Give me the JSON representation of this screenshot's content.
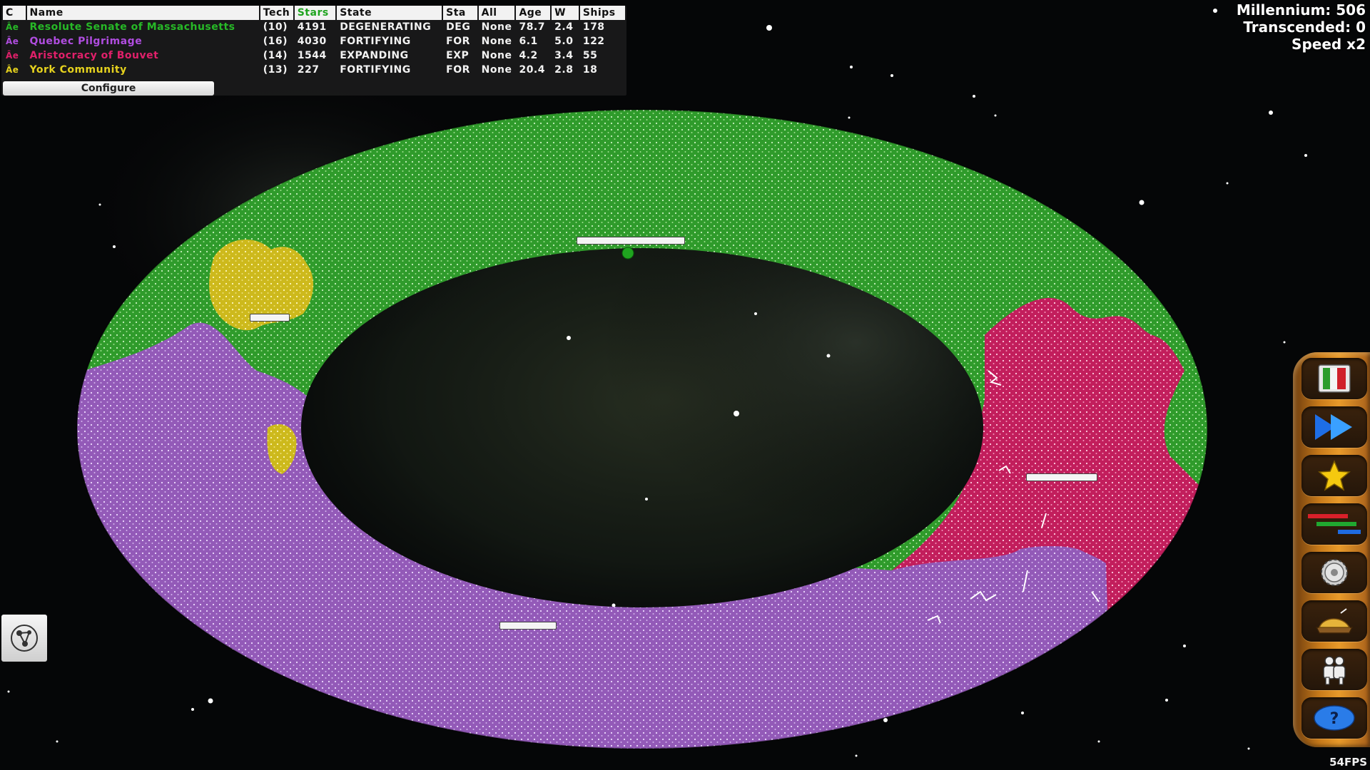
{
  "table": {
    "headers": {
      "c": "C",
      "name": "Name",
      "tech": "Tech",
      "stars": "Stars",
      "state": "State",
      "sta": "Sta",
      "all": "All",
      "age": "Age",
      "w": "W",
      "ships": "Ships"
    },
    "rows": [
      {
        "glyph": "Âe",
        "name": "Resolute Senate of Massachusetts",
        "color": "#27b927",
        "tech": "(10)",
        "stars": "4191",
        "state": "DEGENERATING",
        "sta": "DEG",
        "all": "None",
        "age": "78.7",
        "w": "2.4",
        "ships": "178"
      },
      {
        "glyph": "Âe",
        "name": "Quebec Pilgrimage",
        "color": "#b04de0",
        "tech": "(16)",
        "stars": "4030",
        "state": "FORTIFYING",
        "sta": "FOR",
        "all": "None",
        "age": "6.1",
        "w": "5.0",
        "ships": "122"
      },
      {
        "glyph": "Âe",
        "name": "Aristocracy of Bouvet",
        "color": "#e0206a",
        "tech": "(14)",
        "stars": "1544",
        "state": "EXPANDING",
        "sta": "EXP",
        "all": "None",
        "age": "4.2",
        "w": "3.4",
        "ships": "55"
      },
      {
        "glyph": "Âe",
        "name": "York Community",
        "color": "#e6d21e",
        "tech": "(13)",
        "stars": "227",
        "state": "FORTIFYING",
        "sta": "FOR",
        "all": "None",
        "age": "20.4",
        "w": "2.8",
        "ships": "18"
      }
    ],
    "configure_label": "Configure"
  },
  "stats": {
    "millennium": "Millennium: 506",
    "transcended": "Transcended: 0",
    "speed": "Speed x2"
  },
  "fps": "54FPS",
  "toolbar": {
    "buttons": [
      {
        "name": "flag-icon"
      },
      {
        "name": "fast-forward-icon"
      },
      {
        "name": "star-icon"
      },
      {
        "name": "bars-icon"
      },
      {
        "name": "gear-icon"
      },
      {
        "name": "treasure-icon"
      },
      {
        "name": "people-icon"
      },
      {
        "name": "help-icon"
      }
    ]
  },
  "colors": {
    "green_empire": "#2e9a2a",
    "purple_empire": "#9a5ac0",
    "crimson_empire": "#c8205e",
    "yellow_empire": "#d8c21a",
    "toolbar": "#d98a22"
  }
}
